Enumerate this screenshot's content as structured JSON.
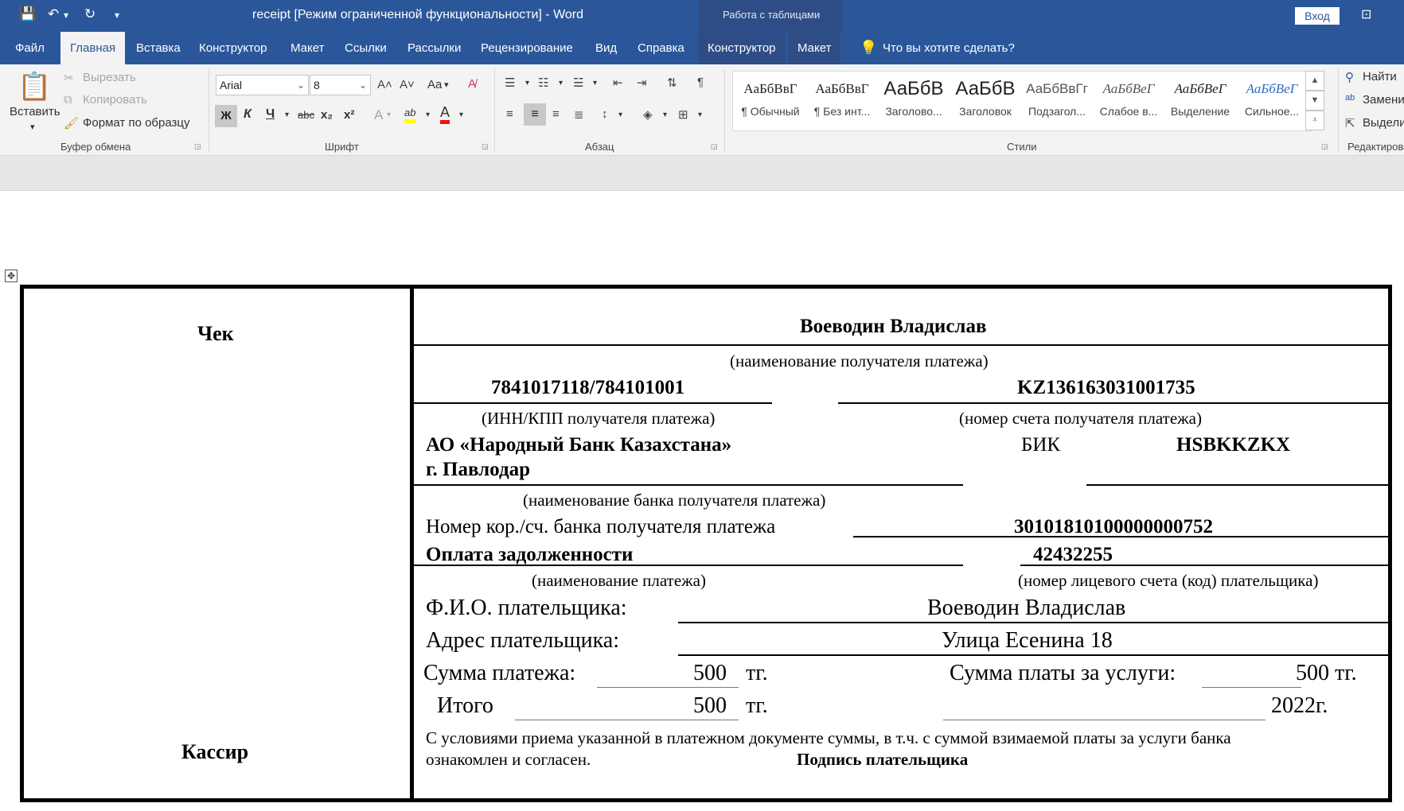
{
  "titlebar": {
    "title": "receipt [Режим ограниченной функциональности]  -  Word",
    "context_title": "Работа с таблицами",
    "login": "Вход"
  },
  "tabs": [
    "Файл",
    "Главная",
    "Вставка",
    "Конструктор",
    "Макет",
    "Ссылки",
    "Рассылки",
    "Рецензирование",
    "Вид",
    "Справка",
    "Конструктор",
    "Макет"
  ],
  "tell_me": "Что вы хотите сделать?",
  "ribbon": {
    "clipboard": {
      "paste": "Вставить",
      "cut": "Вырезать",
      "copy": "Копировать",
      "format_painter": "Формат по образцу",
      "label": "Буфер обмена"
    },
    "font": {
      "family": "Arial",
      "size": "8",
      "case": "Aa",
      "bold": "Ж",
      "italic": "К",
      "underline": "Ч",
      "strike": "abc",
      "subscript": "x₂",
      "superscript": "x²",
      "text_effects": "A",
      "highlight": "ab",
      "font_color": "A",
      "label": "Шрифт"
    },
    "paragraph": {
      "label": "Абзац"
    },
    "styles": {
      "label": "Стили",
      "items": [
        {
          "sample": "АаБбВвГ",
          "name": "¶ Обычный"
        },
        {
          "sample": "АаБбВвГ",
          "name": "¶ Без инт..."
        },
        {
          "sample": "АаБбВ",
          "name": "Заголово..."
        },
        {
          "sample": "АаБбВ",
          "name": "Заголовок"
        },
        {
          "sample": "АаБбВвГг",
          "name": "Подзагол..."
        },
        {
          "sample": "АаБбВеГ",
          "name": "Слабое в..."
        },
        {
          "sample": "АаБбВеГ",
          "name": "Выделение"
        },
        {
          "sample": "АаБбВеГ",
          "name": "Сильное..."
        }
      ]
    },
    "editing": {
      "find": "Найти",
      "replace": "Замени",
      "select": "Выдели",
      "label": "Редактирова"
    }
  },
  "receipt": {
    "left_top": "Чек",
    "left_bottom": "Кассир",
    "recipient_name": "Воеводин Владислав",
    "recipient_caption": "(наименование получателя платежа)",
    "inn_kpp": "7841017118/784101001",
    "account": "KZ136163031001735",
    "inn_caption": "(ИНН/КПП получателя платежа)",
    "account_caption": "(номер счета получателя платежа)",
    "bank_line1": "АО «Народный Банк Казахстана»",
    "bank_line2": "г. Павлодар",
    "bik_label": "БИК",
    "bik_value": "HSBKKZKX",
    "bank_caption": "(наименование банка получателя платежа)",
    "corr_label": "Номер кор./сч. банка получателя платежа",
    "corr_value": "30101810100000000752",
    "payment_name": "Оплата задолженности",
    "personal_account": "42432255",
    "payment_caption": "(наименование платежа)",
    "personal_caption": "(номер лицевого счета (код) плательщика)",
    "payer_label": "Ф.И.О. плательщика:",
    "payer_value": "Воеводин Владислав",
    "address_label": "Адрес плательщика:",
    "address_value": "Улица Есенина 18",
    "sum_label": "Сумма платежа:",
    "sum_value": "500",
    "currency": "тг.",
    "fee_label": "Сумма платы за услуги:",
    "fee_value": "500 тг.",
    "total_label": "Итого",
    "total_value": "500",
    "year": "2022г.",
    "terms_line1": "С условиями приема указанной в платежном документе суммы, в т.ч. с суммой взимаемой платы за услуги банка",
    "terms_line2": "ознакомлен и согласен.",
    "signature": "Подпись плательщика"
  }
}
